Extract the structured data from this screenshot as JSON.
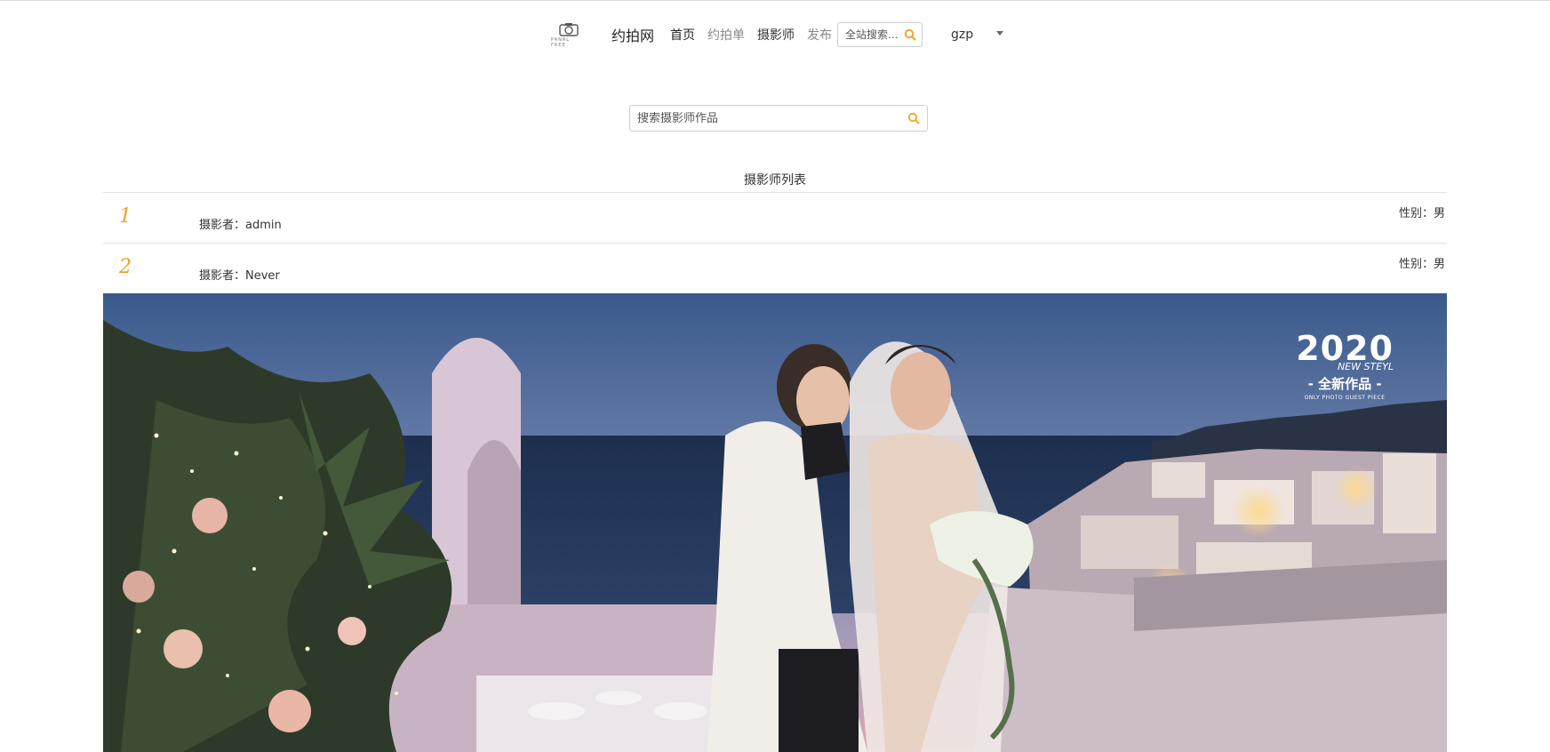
{
  "header": {
    "logo_text": "PANAL FREE",
    "site_name": "约拍网",
    "nav": [
      {
        "label": "首页"
      },
      {
        "label": "约拍单"
      },
      {
        "label": "摄影师"
      },
      {
        "label": "发布"
      }
    ],
    "search_placeholder": "全站搜索...",
    "username": "gzp"
  },
  "main_search": {
    "placeholder": "搜索摄影师作品"
  },
  "list": {
    "title": "摄影师列表",
    "rows": [
      {
        "index": "1",
        "name": "摄影者：admin",
        "gender": "性别：男"
      },
      {
        "index": "2",
        "name": "摄影者：Never",
        "gender": "性别：男"
      }
    ]
  },
  "banner": {
    "year": "2020",
    "sub": "NEW STEYL",
    "title": "- 全新作品 -",
    "tiny": "ONLY PHOTO GUEST PIECE"
  },
  "colors": {
    "accent": "#f0a020",
    "search_icon": "#f5a623"
  },
  "icons": {
    "top_search": "search-icon",
    "main_search": "search-icon",
    "user_menu": "caret-down-icon"
  }
}
